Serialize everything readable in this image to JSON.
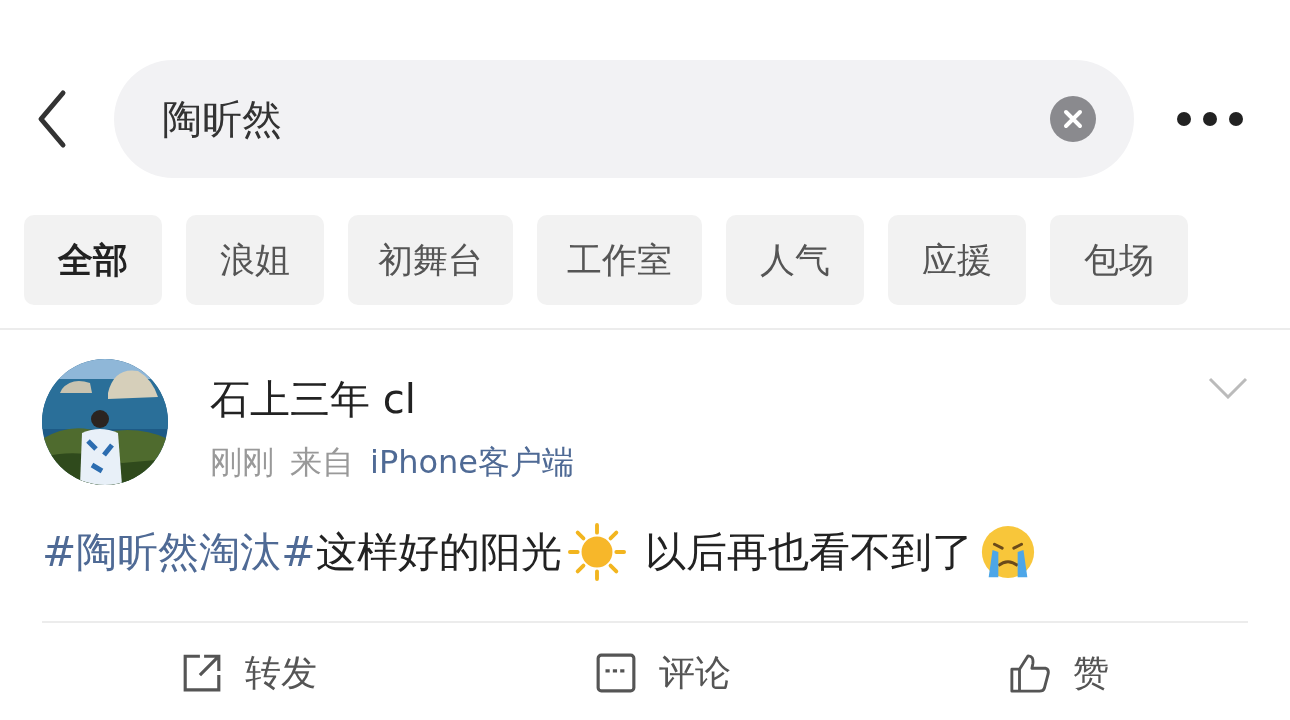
{
  "search": {
    "value": "陶昕然"
  },
  "chips": [
    {
      "label": "全部",
      "selected": true
    },
    {
      "label": "浪姐",
      "selected": false
    },
    {
      "label": "初舞台",
      "selected": false
    },
    {
      "label": "工作室",
      "selected": false
    },
    {
      "label": "人气",
      "selected": false
    },
    {
      "label": "应援",
      "selected": false
    },
    {
      "label": "包场",
      "selected": false
    }
  ],
  "post": {
    "author": "石上三年 cl",
    "time": "刚刚",
    "source_prefix": "来自",
    "source": "iPhone客户端",
    "content": [
      {
        "kind": "hashtag",
        "text": "#陶昕然淘汰#"
      },
      {
        "kind": "text",
        "text": "这样好的阳光"
      },
      {
        "kind": "sun"
      },
      {
        "kind": "text",
        "text": " 以后再也看不到了"
      },
      {
        "kind": "crying"
      }
    ]
  },
  "actions": [
    {
      "kind": "repost",
      "label": "转发"
    },
    {
      "kind": "comment",
      "label": "评论"
    },
    {
      "kind": "like",
      "label": "赞"
    }
  ]
}
